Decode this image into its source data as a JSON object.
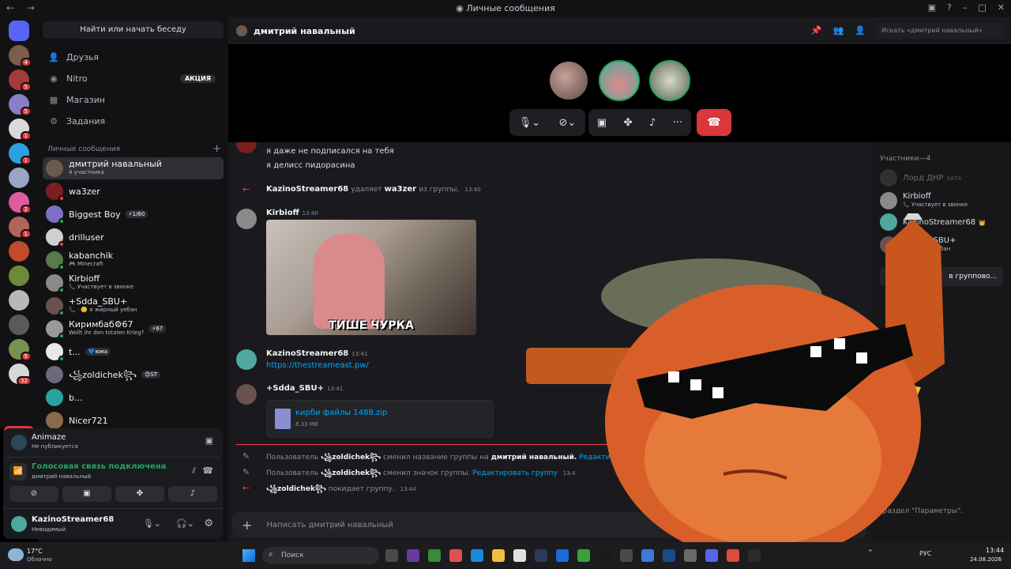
{
  "window": {
    "title": "Личные сообщения",
    "nav": "← →",
    "controls": [
      "▣",
      "?",
      "–",
      "□",
      "✕"
    ]
  },
  "rail": {
    "new_badge": "НОВОЕ",
    "servers": [
      {
        "color": "#5865f2",
        "badge": ""
      },
      {
        "color": "#7c5c4a",
        "badge": "4"
      },
      {
        "color": "#a33b3b",
        "badge": "5"
      },
      {
        "color": "#8b7ec9",
        "badge": "5"
      },
      {
        "color": "#d9d9d9",
        "badge": "1"
      },
      {
        "color": "#2ea0e0",
        "badge": "1"
      },
      {
        "color": "#9aa4c4",
        "badge": ""
      },
      {
        "color": "#e05aa0",
        "badge": "2"
      },
      {
        "color": "#b0645a",
        "badge": "1"
      },
      {
        "color": "#c24b2a",
        "badge": ""
      },
      {
        "color": "#6c8a3a",
        "badge": ""
      },
      {
        "color": "#b8b8b8",
        "badge": ""
      },
      {
        "color": "#5a5a5a",
        "badge": ""
      },
      {
        "color": "#79914f",
        "badge": "5"
      },
      {
        "color": "#d7d7d7",
        "badge": "32"
      }
    ]
  },
  "sidebar": {
    "search_label": "Найти или начать беседу",
    "nav": [
      {
        "icon": "friends-icon",
        "glyph": "👤",
        "label": "Друзья"
      },
      {
        "icon": "nitro-icon",
        "glyph": "◉",
        "label": "Nitro",
        "promo": "АКЦИЯ"
      },
      {
        "icon": "shop-icon",
        "glyph": "▦",
        "label": "Магазин"
      },
      {
        "icon": "quests-icon",
        "glyph": "⚙",
        "label": "Задания"
      }
    ],
    "dm_header": "Личные сообщения",
    "dm_add": "+",
    "dms": [
      {
        "name": "дмитрий навальный",
        "sub": "4 участника",
        "color": "#6b5a4e",
        "status": ""
      },
      {
        "name": "wa3zer",
        "sub": "",
        "color": "#7a1f1f",
        "status": "#f23f43"
      },
      {
        "name": "Biggest Boy",
        "sub": "",
        "badge": "⚡1/60",
        "color": "#7d6fc4",
        "status": "#23a55a"
      },
      {
        "name": "drilluser",
        "sub": "",
        "color": "#d0d0d0",
        "status": "#f23f43"
      },
      {
        "name": "kabanchik",
        "sub": "🎮 Minecraft",
        "color": "#5a7a4a",
        "status": "#23a55a"
      },
      {
        "name": "Kirbioff",
        "sub": "📞 Участвует в звонке",
        "color": "#8a8a8a",
        "status": "#23a55a"
      },
      {
        "name": "+Sdda_SBU+",
        "sub": "📞 · 🙂 я жирный уебан",
        "color": "#6b5050",
        "status": "#23a55a"
      },
      {
        "name": "Киримбаб⚙67",
        "sub": "Wollt ihr den totalen Krieg?",
        "badge": "⚡67",
        "color": "#9a9a9a",
        "status": "#23a55a"
      },
      {
        "name": "t...",
        "sub": "",
        "badge": "💙юма",
        "color": "#e8e8e8",
        "status": "#23a55a"
      },
      {
        "name": "꧁zoldichek꧂",
        "sub": "",
        "badge": "😊ST",
        "color": "#6a6a7a",
        "status": ""
      },
      {
        "name": "b...",
        "sub": "",
        "color": "#2aa0a0",
        "status": ""
      },
      {
        "name": "Nicer721",
        "sub": "",
        "color": "#8a6a4a",
        "status": ""
      }
    ]
  },
  "panel": {
    "app_name": "Animaze",
    "app_sub": "Не публикуется",
    "voice_status": "Голосовая связь подключена",
    "voice_channel": "дмитрий навальный",
    "user": "KazinoStreamer68",
    "user_status": "Невидимый"
  },
  "header": {
    "channel": "дмитрий навальный",
    "search_placeholder": "Искать «дмитрий навальный»"
  },
  "call": {
    "avatars": [
      "#8a6a5a",
      "#4fa8a0",
      "#6a7a5a"
    ],
    "hangup": "☎"
  },
  "messages": [
    {
      "type": "text",
      "text": "я даже не подписался на тебя"
    },
    {
      "type": "text",
      "text": "я делисс пидорасина"
    },
    {
      "type": "system",
      "actor": "KazinoStreamer68",
      "action": "удаляет",
      "target": "wa3zer",
      "rest": "из группы.",
      "time": "13:40"
    },
    {
      "type": "msg",
      "author": "Kirbioff",
      "time": "13:40",
      "gif_caption": "ТИШЕ ЧУРКА"
    },
    {
      "type": "msg",
      "author": "KazinoStreamer68",
      "time": "13:41",
      "link": "https://thestreameast.pw/"
    },
    {
      "type": "msg",
      "author": "+Sdda_SBU+",
      "time": "13:41",
      "file_name": "кирби файлы 1488.zip",
      "file_size": "8.33 MB"
    },
    {
      "type": "system2",
      "pre": "Пользователь",
      "actor": "꧁zoldichek꧂",
      "action": "сменил название группы на",
      "target": "дмитрий навальный.",
      "link": "Редактировать группу"
    },
    {
      "type": "system2",
      "pre": "Пользователь",
      "actor": "꧁zoldichek꧂",
      "action": "сменил значок группы.",
      "link": "Редактировать группу",
      "time": "13:4"
    },
    {
      "type": "system3",
      "actor": "꧁zoldichek꧂",
      "action": "покидает группу.",
      "time": "13:44"
    }
  ],
  "members": {
    "header": "Участники—4",
    "list": [
      {
        "name": "Лорд ДНР",
        "tag": "ХАТА",
        "sub": "",
        "color": "#5a5a5a",
        "dim": true
      },
      {
        "name": "Kirbioff",
        "tag": "",
        "sub": "📞 Участвует в звонке",
        "color": "#8a8a8a"
      },
      {
        "name": "KazinoStreamer68",
        "tag": "👑",
        "sub": "",
        "color": "#4fa8a0"
      },
      {
        "name": "+Sdda_SBU+",
        "tag": "",
        "sub": "я жирный уебан",
        "color": "#6b5050"
      }
    ],
    "invite_btn": "в группово..."
  },
  "input": {
    "placeholder": "Написать дмитрий навальный"
  },
  "overlay": {
    "windows_note": "ows, перейдите в раздел \"Параметры\"."
  },
  "taskbar": {
    "weather_temp": "17°C",
    "weather_text": "Облачно",
    "search": "Поиск",
    "lang": "РУС",
    "time": "13:44",
    "date": "24.08.2026"
  }
}
